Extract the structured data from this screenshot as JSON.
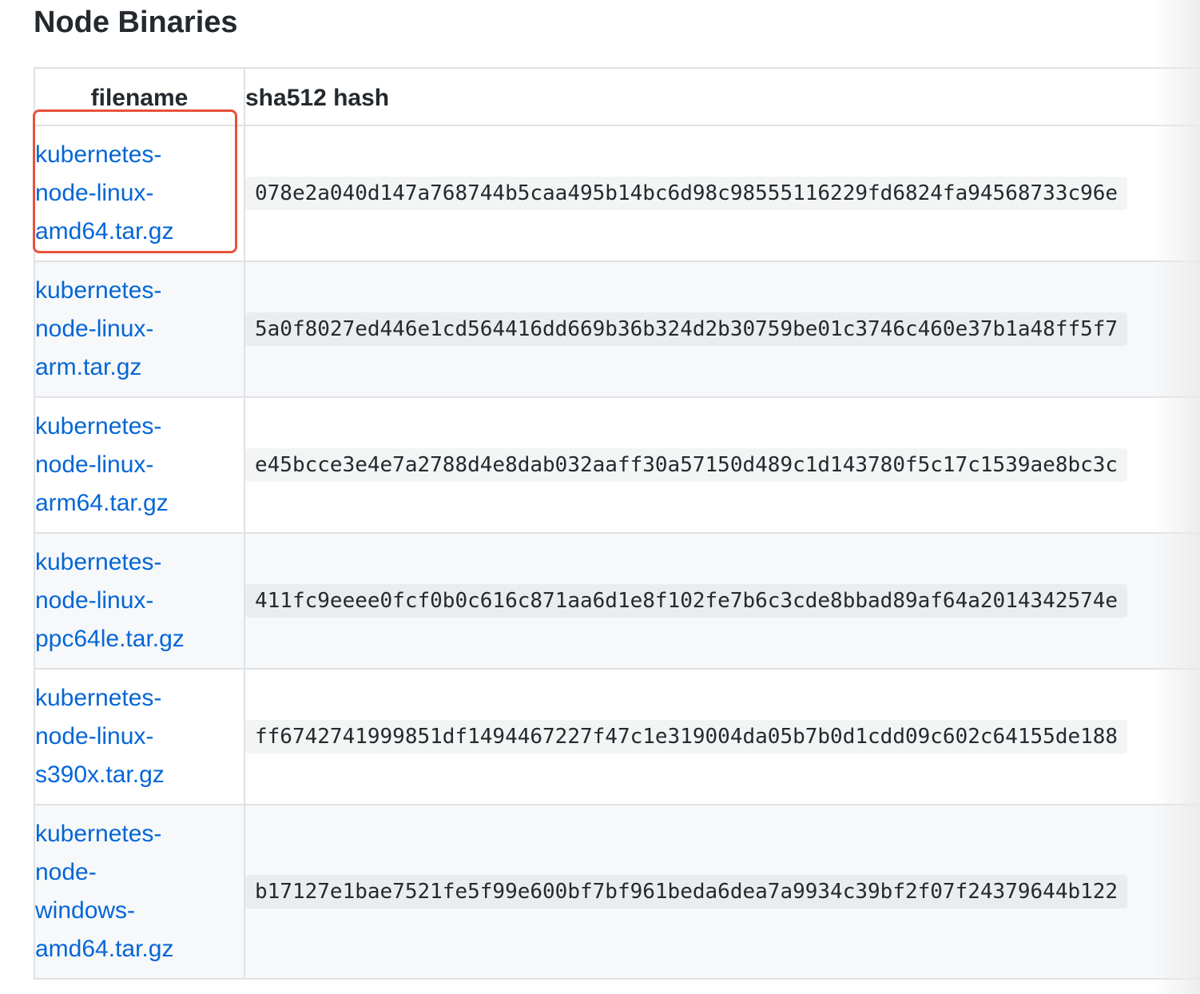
{
  "section": {
    "title": "Node Binaries"
  },
  "table": {
    "headers": {
      "filename": "filename",
      "hash": "sha512 hash"
    },
    "rows": [
      {
        "filename_lines": [
          "kubernetes-",
          "node-linux-",
          "amd64.tar.gz"
        ],
        "hash": "078e2a040d147a768744b5caa495b14bc6d98c98555116229fd6824fa94568733c96e"
      },
      {
        "filename_lines": [
          "kubernetes-",
          "node-linux-",
          "arm.tar.gz"
        ],
        "hash": "5a0f8027ed446e1cd564416dd669b36b324d2b30759be01c3746c460e37b1a48ff5f7"
      },
      {
        "filename_lines": [
          "kubernetes-",
          "node-linux-",
          "arm64.tar.gz"
        ],
        "hash": "e45bcce3e4e7a2788d4e8dab032aaff30a57150d489c1d143780f5c17c1539ae8bc3c"
      },
      {
        "filename_lines": [
          "kubernetes-",
          "node-linux-",
          "ppc64le.tar.gz"
        ],
        "hash": "411fc9eeee0fcf0b0c616c871aa6d1e8f102fe7b6c3cde8bbad89af64a2014342574e"
      },
      {
        "filename_lines": [
          "kubernetes-",
          "node-linux-",
          "s390x.tar.gz"
        ],
        "hash": "ff6742741999851df1494467227f47c1e319004da05b7b0d1cdd09c602c64155de188"
      },
      {
        "filename_lines": [
          "kubernetes-",
          "node-",
          "windows-",
          "amd64.tar.gz"
        ],
        "hash": "b17127e1bae7521fe5f99e600bf7bf961beda6dea7a9934c39bf2f07f24379644b122"
      }
    ]
  },
  "colors": {
    "link": "#0366d6",
    "highlight": "#e8513a",
    "border": "#dfe2e5",
    "stripe": "#f6f8fa"
  }
}
